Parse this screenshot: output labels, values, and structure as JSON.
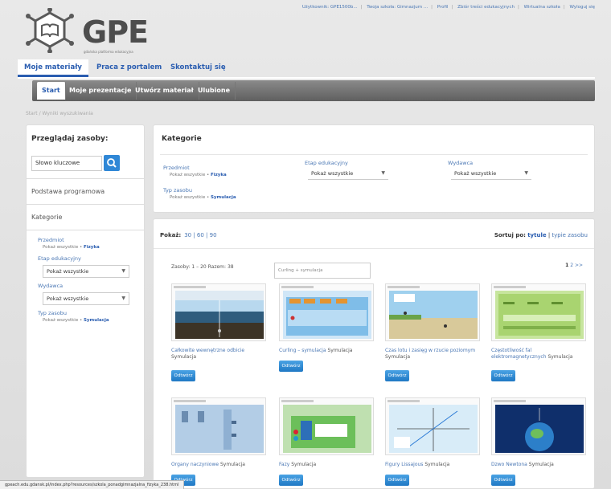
{
  "header": {
    "logo_text": "GPE",
    "logo_sub": "gdańska platforma edukacyjna",
    "top_links": [
      "Użytkownik: GPE1500b...",
      "Twoja szkoła: Gimnazjum ...",
      "Profil",
      "Zbiór treści edukacyjnych",
      "Wirtualna szkoła",
      "Wyloguj się"
    ]
  },
  "main_tabs": [
    "Moje materiały",
    "Praca z portalem",
    "Skontaktuj się"
  ],
  "subnav": [
    "Start",
    "Moje prezentacje",
    "Utwórz materiał",
    "Ulubione"
  ],
  "breadcrumb": "Start / Wyniki wyszukiwania",
  "sidebar": {
    "title": "Przeglądaj zasoby:",
    "search_value": "Słowo kluczowe",
    "link1": "Podstawa programowa",
    "link2": "Kategorie",
    "f_przedmiot": "Przedmiot",
    "f_przedmiot_val": "Pokaż wszystkie • ",
    "f_przedmiot_sel": "Fizyka",
    "f_etap": "Etap edukacyjny",
    "f_etap_val": "Pokaż wszystkie",
    "f_wydawca": "Wydawca",
    "f_wydawca_val": "Pokaż wszystkie",
    "f_typ": "Typ zasobu",
    "f_typ_val": "Pokaż wszystkie • ",
    "f_typ_sel": "Symulacja"
  },
  "categories": {
    "title": "Kategorie",
    "przedmiot": "Przedmiot",
    "przedmiot_val": "Pokaż wszystkie • ",
    "przedmiot_sel": "Fizyka",
    "etap": "Etap edukacyjny",
    "etap_val": "Pokaż wszystkie",
    "wydawca": "Wydawca",
    "wydawca_val": "Pokaż wszystkie",
    "typ": "Typ zasobu",
    "typ_val": "Pokaż wszystkie • ",
    "typ_sel": "Symulacja"
  },
  "results": {
    "pokaz_label": "Pokaż:",
    "pokaz_options": "30 | 60 | 90",
    "sort_label": "Sortuj po:",
    "sort_opt1": "tytule",
    "sort_opt2": "typie zasobu",
    "count": "Zasoby: 1 – 20 Razem: 38",
    "search_hint": "Curling + symulacja",
    "pager_current": "1",
    "pager_rest": "2 >>",
    "button_label": "Odtwórz",
    "cards": [
      {
        "title": "Całkowite wewnętrzne odbicie",
        "type": "Symulacja"
      },
      {
        "title": "Curling – symulacja",
        "type": "Symulacja"
      },
      {
        "title": "Czas lotu i zasięg w rzucie poziomym",
        "type": "Symulacja"
      },
      {
        "title": "Częstotliwość fal elektromagnetycznych",
        "type": "Symulacja"
      },
      {
        "title": "Organy naczyniowe",
        "type": "Symulacja"
      },
      {
        "title": "Fazy",
        "type": "Symulacja"
      },
      {
        "title": "Figury Lissajous",
        "type": "Symulacja"
      },
      {
        "title": "Dzwo Newtona",
        "type": "Symulacja"
      }
    ]
  },
  "status_bar": "gpeach.edu.gdansk.pl/index.php?resources/szkola_ponadgimnazjalna_fizyka_238.html",
  "colors": {
    "accent": "#2a5db0",
    "button": "#1f78c4",
    "subnav": "#6b6b6b"
  }
}
